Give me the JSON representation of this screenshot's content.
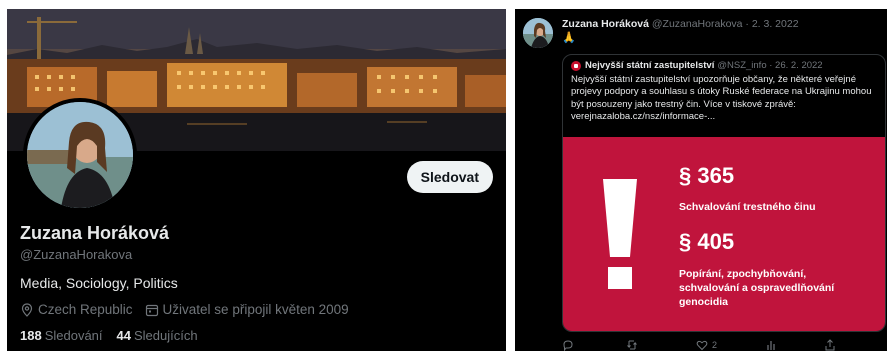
{
  "profile": {
    "display_name": "Zuzana Horáková",
    "handle": "@ZuzanaHorakova",
    "follow_label": "Sledovat",
    "bio": "Media, Sociology, Politics",
    "location": "Czech Republic",
    "joined": "Uživatel se připojil květen 2009",
    "following_count": "188",
    "following_label": "Sledování",
    "followers_count": "44",
    "followers_label": "Sledujících",
    "icons": {
      "location": "location-pin-icon",
      "joined": "calendar-icon"
    }
  },
  "tweet": {
    "author_name": "Zuzana Horáková",
    "author_meta": "@ZuzanaHorakova · 2. 3. 2022",
    "text": "🙏",
    "quote": {
      "author_name": "Nejvyšší státní zastupitelství",
      "author_meta": "@NSZ_info · 26. 2. 2022",
      "text": "Nejvyšší státní zastupitelství upozorňuje občany, že některé veřejné projevy podpory a souhlasu s útoky Ruské federace na Ukrajinu mohou být posouzeny jako trestný čin. Více v tiskové zprávě: verejnazaloba.cz/nsz/informace-...",
      "card": {
        "section1": "§ 365",
        "section1_text": "Schvalování trestného činu",
        "section2": "§ 405",
        "section2_text": "Popírání, zpochybňování, schvalování a ospravedlňování genocidia",
        "bg_color": "#c0143c"
      }
    },
    "actions": {
      "reply_count": "",
      "retweet_count": "",
      "like_count": "2",
      "views_count": ""
    }
  },
  "colors": {
    "background": "#000000",
    "text_primary": "#e7e9ea",
    "text_secondary": "#71767b",
    "button_bg": "#eff3f4"
  }
}
